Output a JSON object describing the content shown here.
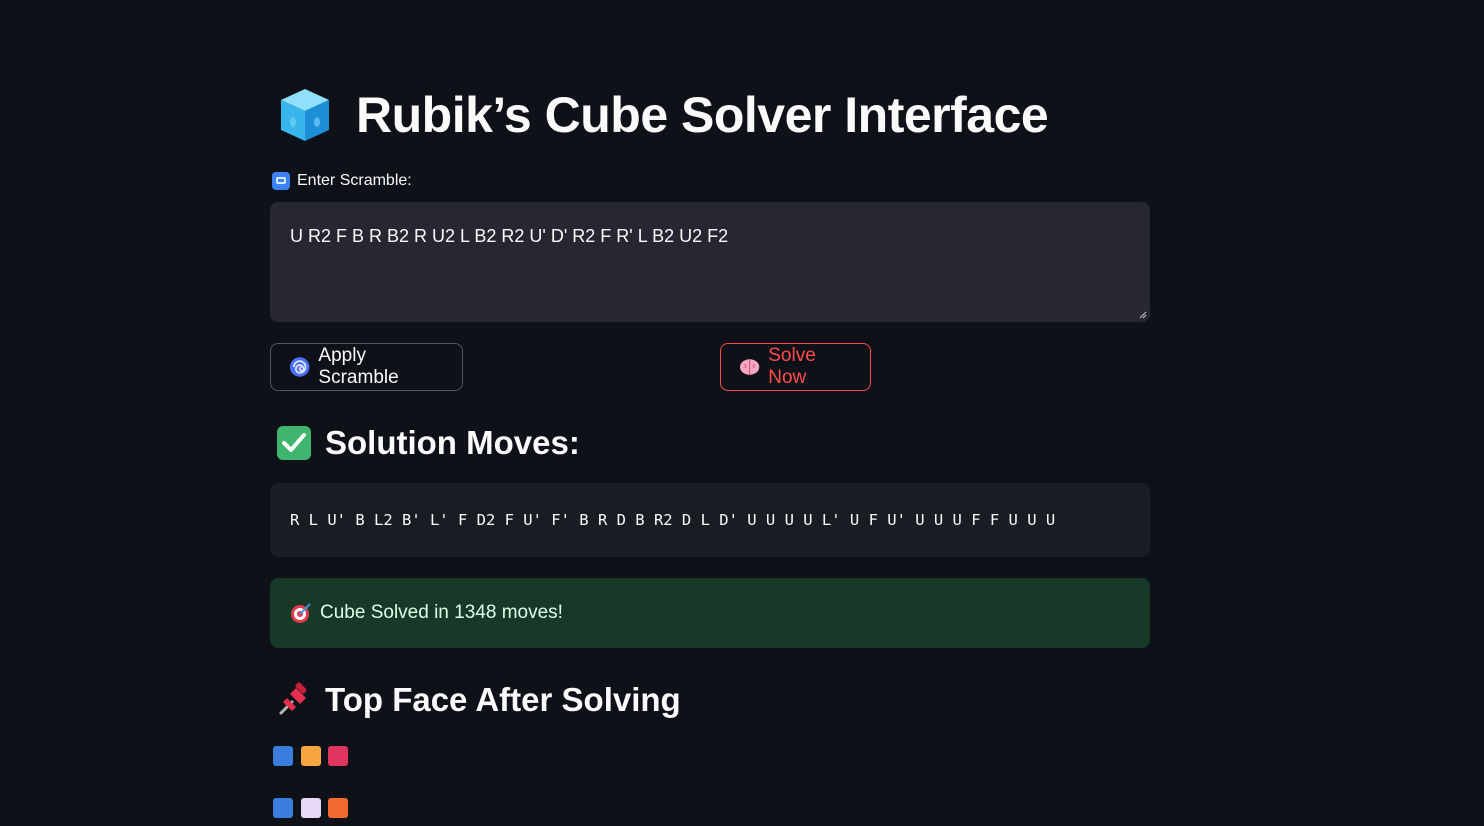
{
  "title": "Rubik’s Cube Solver Interface",
  "scramble_label": "Enter Scramble:",
  "scramble_value": "U R2 F B R B2 R U2 L B2 R2 U' D' R2 F R' L B2 U2 F2",
  "apply_button": "Apply Scramble",
  "solve_button": "Solve Now",
  "solution_heading": "Solution Moves:",
  "solution_moves": "R L U' B L2 B' L' F D2 F U' F' B R D B R2 D L D' U U U U L' U F U' U U U F F U U U",
  "success_message": "Cube Solved in 1348 moves!",
  "top_face_heading": "Top Face After Solving",
  "top_face": [
    [
      "#3b7ddd",
      "#f7a540",
      "#e0355e"
    ],
    [
      "#3b7ddd",
      "#e6d9f5",
      "#f26b2e"
    ]
  ],
  "icons": {
    "title": "ice-cube-icon",
    "label": "input-symbols-icon",
    "apply": "cyclone-icon",
    "solve": "brain-icon",
    "solution": "check-mark-icon",
    "success": "direct-hit-icon",
    "top_face": "pushpin-icon"
  },
  "colors": {
    "background": "#0e1117",
    "input_bg": "#262730",
    "primary": "#ff4b4b",
    "success_bg": "#173928"
  }
}
